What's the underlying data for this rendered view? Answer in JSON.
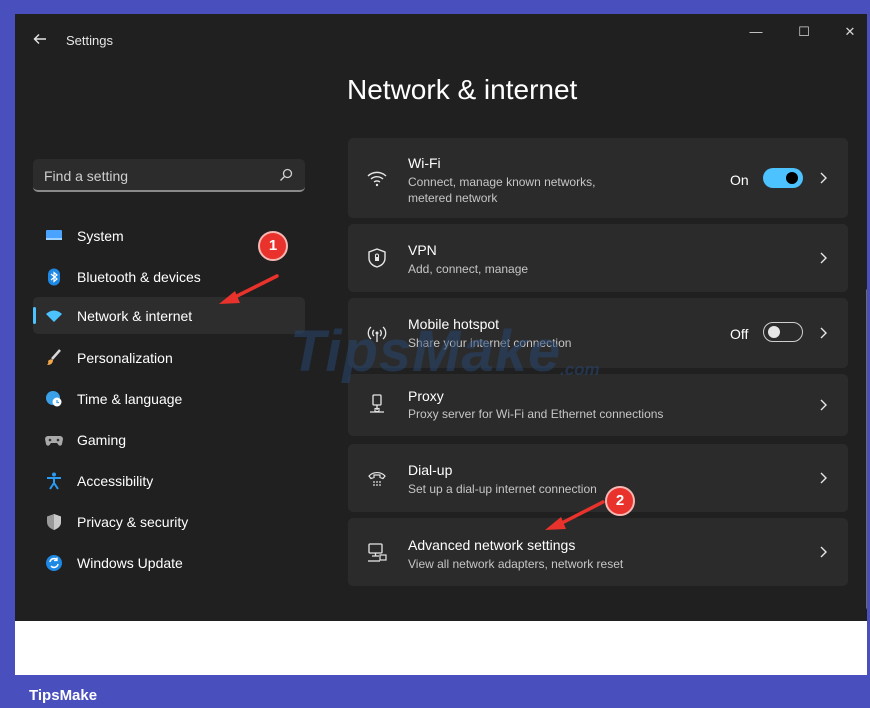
{
  "window": {
    "app_title": "Settings",
    "page_title": "Network & internet",
    "controls": {
      "minimize": "—",
      "maximize": "☐",
      "close": "✕"
    }
  },
  "search": {
    "placeholder": "Find a setting",
    "icon": "search-icon"
  },
  "nav": {
    "items": [
      {
        "label": "System",
        "icon": "monitor-icon",
        "color": "#4aa3ff"
      },
      {
        "label": "Bluetooth & devices",
        "icon": "bluetooth-icon",
        "color": "#1e88e5"
      },
      {
        "label": "Network & internet",
        "icon": "wifi-icon",
        "color": "#4cc2ff",
        "active": true
      },
      {
        "label": "Personalization",
        "icon": "brush-icon",
        "color": "#f2a64a"
      },
      {
        "label": "Time & language",
        "icon": "globe-clock-icon",
        "color": "#3aa0e8"
      },
      {
        "label": "Gaming",
        "icon": "gamepad-icon",
        "color": "#a0a0a0"
      },
      {
        "label": "Accessibility",
        "icon": "accessibility-icon",
        "color": "#2b9af3"
      },
      {
        "label": "Privacy & security",
        "icon": "shield-icon",
        "color": "#9a9a9a"
      },
      {
        "label": "Windows Update",
        "icon": "update-icon",
        "color": "#1e88e5"
      }
    ]
  },
  "cards": [
    {
      "title": "Wi-Fi",
      "subtitle_line1": "Connect, manage known networks,",
      "subtitle_line2": "metered network",
      "icon": "wifi-icon",
      "toggle_label": "On",
      "toggle": true
    },
    {
      "title": "VPN",
      "subtitle_line1": "Add, connect, manage",
      "icon": "vpn-shield-icon"
    },
    {
      "title": "Mobile hotspot",
      "subtitle_line1": "Share your internet connection",
      "icon": "hotspot-icon",
      "toggle_label": "Off",
      "toggle": false
    },
    {
      "title": "Proxy",
      "subtitle_line1": "Proxy server for Wi-Fi and Ethernet connections",
      "icon": "proxy-icon"
    },
    {
      "title": "Dial-up",
      "subtitle_line1": "Set up a dial-up internet connection",
      "icon": "dialup-icon"
    },
    {
      "title": "Advanced network settings",
      "subtitle_line1": "View all network adapters, network reset",
      "icon": "network-adapter-icon"
    }
  ],
  "annotations": {
    "badge1": "1",
    "badge2": "2",
    "color": "#e8322b"
  },
  "watermark": {
    "text": "TipsMake",
    "suffix": ".com"
  },
  "footer": {
    "brand": "TipsMake"
  },
  "colors": {
    "accent": "#4cc2ff",
    "background": "#202020",
    "card": "#2b2b2b",
    "frame": "#4a4fbe"
  }
}
